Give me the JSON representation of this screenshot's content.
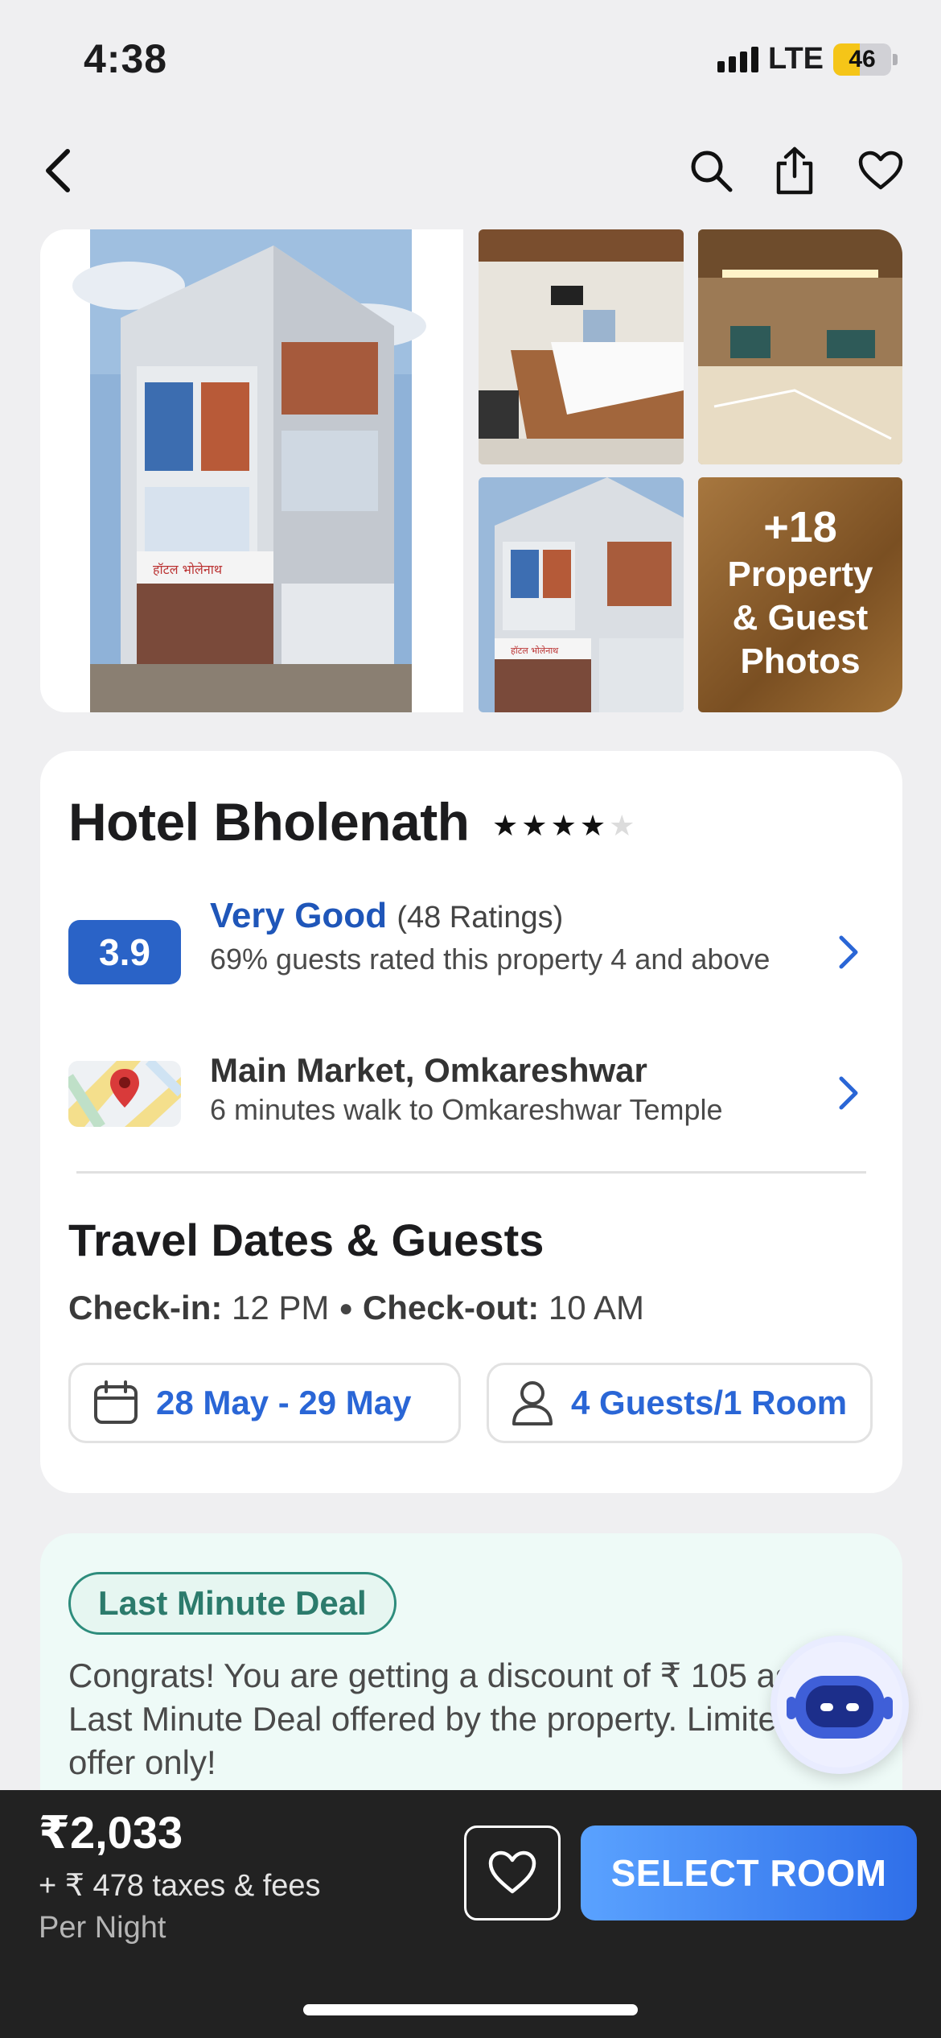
{
  "status_bar": {
    "time": "4:38",
    "network": "LTE",
    "battery": "46",
    "battery_fraction": 0.46
  },
  "nav": {
    "back_icon": "chevron-left-icon",
    "search_icon": "search-icon",
    "share_icon": "share-icon",
    "favorite_icon": "heart-icon"
  },
  "gallery": {
    "more_count": "+18",
    "more_label": "Property & Guest Photos"
  },
  "hotel": {
    "name": "Hotel Bholenath",
    "star_rating": 4,
    "star_max": 5,
    "rating": {
      "score": "3.9",
      "label": "Very Good",
      "count": "(48 Ratings)",
      "description": "69% guests rated this property 4 and above"
    },
    "location": {
      "title": "Main Market, Omkareshwar",
      "subtitle": "6 minutes walk to Omkareshwar Temple"
    }
  },
  "travel": {
    "title": "Travel Dates & Guests",
    "checkin_label": "Check-in:",
    "checkin_value": " 12 PM ",
    "separator": "●",
    "checkout_label": " Check-out:",
    "checkout_value": " 10 AM",
    "dates": "28 May - 29 May",
    "guests": "4 Guests/1 Room"
  },
  "deal": {
    "badge": "Last Minute Deal",
    "text": "Congrats! You are getting a discount of ₹ 105 as a Last Minute Deal offered by the property. Limited time offer only!"
  },
  "bottom": {
    "price": "₹2,033",
    "taxes": "+ ₹ 478 taxes & fees",
    "per_night": "Per Night",
    "cta": "SELECT ROOM"
  },
  "colors": {
    "accent": "#2a63c7",
    "link": "#2a66d6",
    "deal_green": "#2c7b6c",
    "cta_start": "#5aa2ff",
    "cta_end": "#2f6fe9"
  }
}
